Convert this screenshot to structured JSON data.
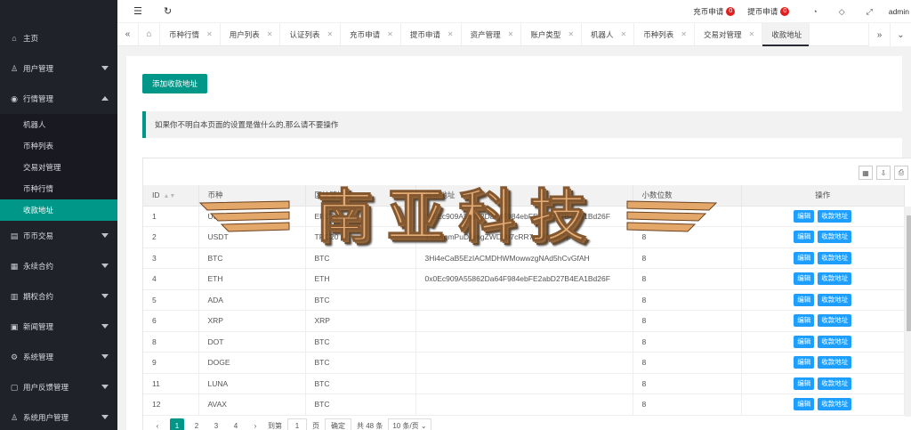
{
  "sidebar": {
    "home": "主页",
    "user_mgmt": "用户管理",
    "market_mgmt": "行情管理",
    "market_sub": [
      "机器人",
      "币种列表",
      "交易对管理",
      "币种行情",
      "收款地址"
    ],
    "coin_trade": "币币交易",
    "perpetual": "永续合约",
    "options": "期权合约",
    "news": "新闻管理",
    "system": "系统管理",
    "feedback": "用户反馈管理",
    "sys_users": "系统用户管理"
  },
  "topbar": {
    "deposit_label": "充币申请",
    "deposit_count": "0",
    "withdraw_label": "提币申请",
    "withdraw_count": "0",
    "user": "admin"
  },
  "tabs": [
    "币种行情",
    "用户列表",
    "认证列表",
    "充币申请",
    "提币申请",
    "资产管理",
    "账户类型",
    "机器人",
    "币种列表",
    "交易对管理",
    "收款地址"
  ],
  "main": {
    "add_button": "添加收款地址",
    "notice": "如果你不明白本页面的设置是做什么的,那么请不要操作"
  },
  "table": {
    "headers": [
      "ID",
      "币种",
      "区块链协议",
      "收款地址",
      "小数位数",
      "操作"
    ],
    "rows": [
      [
        "1",
        "USDT",
        "ERC20",
        "0x0Ec909A55862Da64F984ebFE2abD27B4EA1Bd26F",
        "8"
      ],
      [
        "2",
        "USDT",
        "TRC20",
        "TSzNqmPuDAmgZWDhb7cRR7mUAvuF3p",
        "8"
      ],
      [
        "3",
        "BTC",
        "BTC",
        "3Hi4eCaB5EzIACMDHWMowwzgNAd5hCvGfAH",
        "8"
      ],
      [
        "4",
        "ETH",
        "ETH",
        "0x0Ec909A55862Da64F984ebFE2abD27B4EA1Bd26F",
        "8"
      ],
      [
        "5",
        "ADA",
        "BTC",
        "",
        "8"
      ],
      [
        "6",
        "XRP",
        "XRP",
        "",
        "8"
      ],
      [
        "8",
        "DOT",
        "BTC",
        "",
        "8"
      ],
      [
        "9",
        "DOGE",
        "BTC",
        "",
        "8"
      ],
      [
        "11",
        "LUNA",
        "BTC",
        "",
        "8"
      ],
      [
        "12",
        "AVAX",
        "BTC",
        "",
        "8"
      ]
    ],
    "edit_label": "编辑",
    "address_label": "收款地址"
  },
  "pager": {
    "pages": [
      "1",
      "2",
      "3",
      "4"
    ],
    "goto_label": "到第",
    "goto_value": "1",
    "page_unit": "页",
    "confirm": "确定",
    "total": "共 48 条",
    "page_size": "10 条/页"
  },
  "watermark": "南亚科技"
}
